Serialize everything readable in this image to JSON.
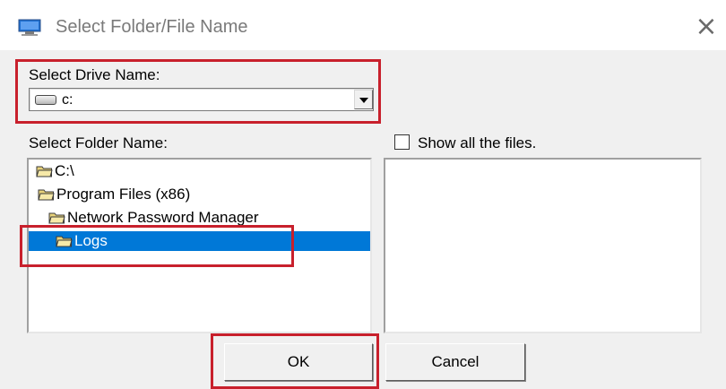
{
  "window": {
    "title": "Select Folder/File  Name",
    "close_glyph": "×",
    "icon": "monitor-icon"
  },
  "drive": {
    "label": "Select Drive Name:",
    "value": "c:",
    "icon": "drive-icon"
  },
  "folders": {
    "label": "Select Folder Name:",
    "items": [
      {
        "label": "C:\\",
        "icon": "open-folder-icon",
        "selected": false
      },
      {
        "label": "Program Files (x86)",
        "icon": "open-folder-icon",
        "selected": false
      },
      {
        "label": "Network Password Manager",
        "icon": "open-folder-icon",
        "selected": false
      },
      {
        "label": "Logs",
        "icon": "open-folder-icon",
        "selected": true
      }
    ]
  },
  "files": {
    "show_all_label": "Show all the files.",
    "show_all_checked": false
  },
  "buttons": {
    "ok_label": "OK",
    "cancel_label": "Cancel"
  },
  "colors": {
    "selection": "#0078d7",
    "annotation": "#c8202c"
  }
}
